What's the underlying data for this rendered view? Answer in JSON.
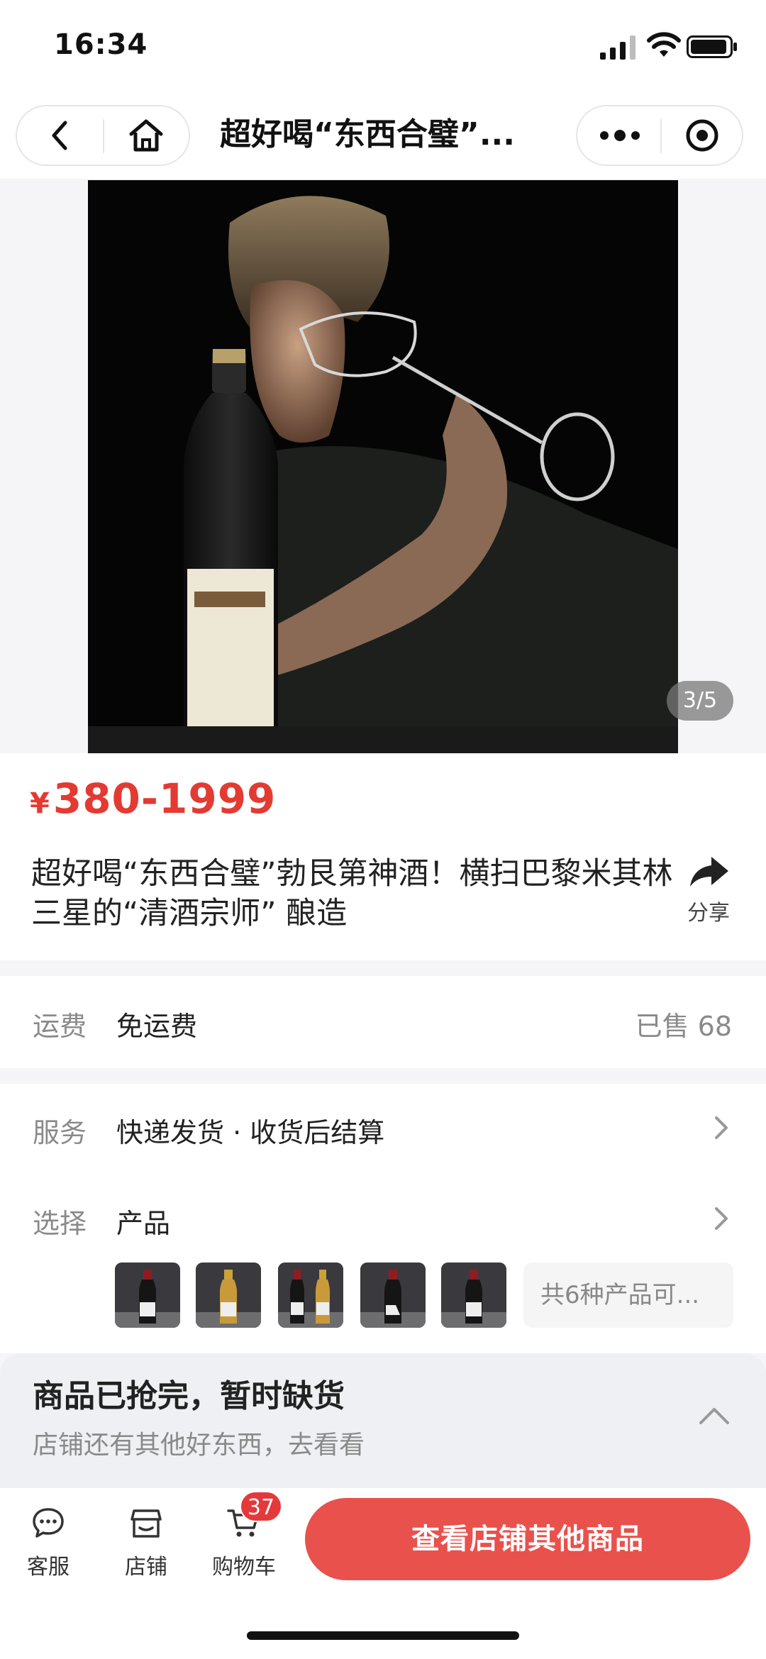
{
  "status_bar": {
    "time": "16:34"
  },
  "nav": {
    "title": "超好喝“东西合璧”..."
  },
  "gallery": {
    "counter": "3/5"
  },
  "product": {
    "price_symbol": "¥",
    "price_range": "380-1999",
    "title": "超好喝“东西合璧”勃艮第神酒！横扫巴黎米其林三星的“清酒宗师” 酿造",
    "share_label": "分享"
  },
  "shipping": {
    "label": "运费",
    "value": "免运费",
    "sold": "已售 68"
  },
  "service": {
    "label": "服务",
    "value": "快递发货 · 收货后结算"
  },
  "select": {
    "label": "选择",
    "value": "产品",
    "more": "共6种产品可...",
    "thumbnails": [
      "red-bottle",
      "gold-bottle",
      "red-and-gold-bottles",
      "dark-bottle",
      "red-bottle"
    ]
  },
  "soldout": {
    "title": "商品已抢完，暂时缺货",
    "subtitle": "店铺还有其他好东西，去看看"
  },
  "bottom_bar": {
    "tabs": [
      {
        "label": "客服",
        "icon": "chat-icon"
      },
      {
        "label": "店铺",
        "icon": "store-icon"
      },
      {
        "label": "购物车",
        "icon": "cart-icon"
      }
    ],
    "cart_badge": "37",
    "cta": "查看店铺其他商品"
  },
  "colors": {
    "price": "#e33a32",
    "cta": "#e9514c",
    "badge": "#e4393c"
  }
}
